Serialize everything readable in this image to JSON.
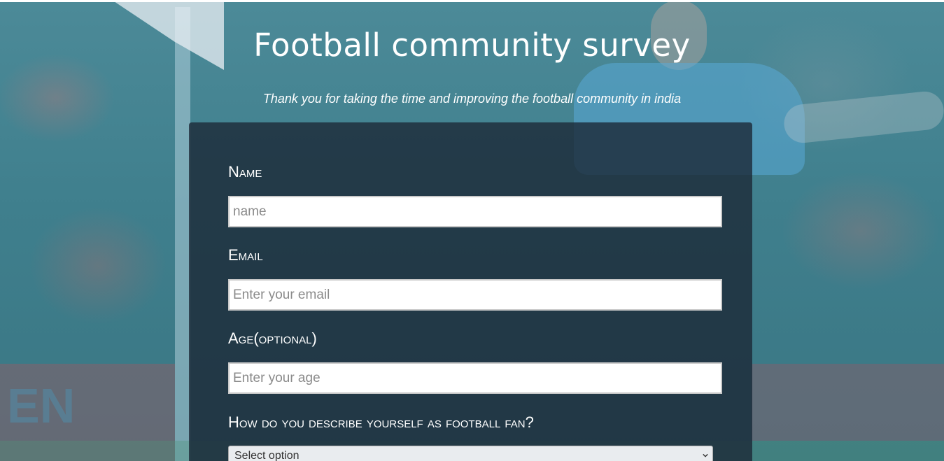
{
  "header": {
    "title": "Football community survey",
    "subtitle": "Thank you for taking the time and improving the football community in india"
  },
  "form": {
    "name": {
      "label": "Name",
      "placeholder": "name",
      "value": ""
    },
    "email": {
      "label": "Email",
      "placeholder": "Enter your email",
      "value": ""
    },
    "age": {
      "label": "Age(optional)",
      "placeholder": "Enter your age",
      "value": ""
    },
    "fan_type": {
      "label": "How do you describe yourself as football fan?",
      "selected": "Select option"
    }
  },
  "background": {
    "banner_text": "EN"
  },
  "colors": {
    "card_background": "#1b2735",
    "overlay_tint": "#3d7d8a",
    "text": "#ffffff"
  }
}
